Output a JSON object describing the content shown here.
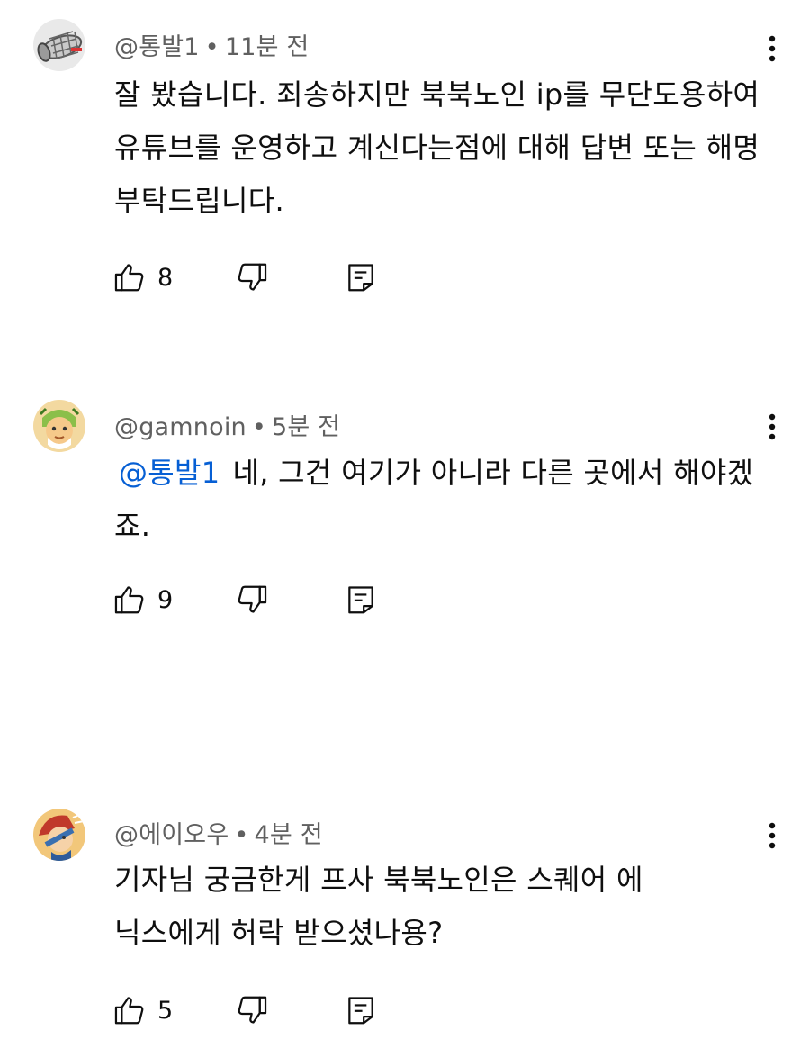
{
  "comments": [
    {
      "author": "@통발1",
      "separator": "•",
      "time": "11분 전",
      "mention": "",
      "text": "잘 봤습니다. 죄송하지만 북북노인 ip를 무단도용하여 유튜브를 운영하고 계신다는점에 대해 답변 또는 해명 부탁드립니다.",
      "likes": "8"
    },
    {
      "author": "@gamnoin",
      "separator": "•",
      "time": "5분 전",
      "mention": "@통발1",
      "text": "네, 그건 여기가 아니라 다른 곳에서 해야겠죠.",
      "likes": "9"
    },
    {
      "author": "@에이오우",
      "separator": "•",
      "time": "4분 전",
      "mention": "",
      "text": "기자님 궁금한게 프사 북북노인은 스퀘어 에닉스에게 허락 받으셨나용?",
      "likes": "5"
    }
  ],
  "icons": {
    "avatar_1": "fish-trap-avatar-icon",
    "avatar_2": "character-avatar-icon",
    "avatar_3": "character-avatar-icon",
    "like": "thumbs-up-icon",
    "dislike": "thumbs-down-icon",
    "reply": "reply-comment-icon",
    "more": "more-vertical-icon"
  },
  "colors": {
    "text": "#0f0f0f",
    "meta": "#606060",
    "mention": "#065fd4",
    "background": "#ffffff"
  }
}
